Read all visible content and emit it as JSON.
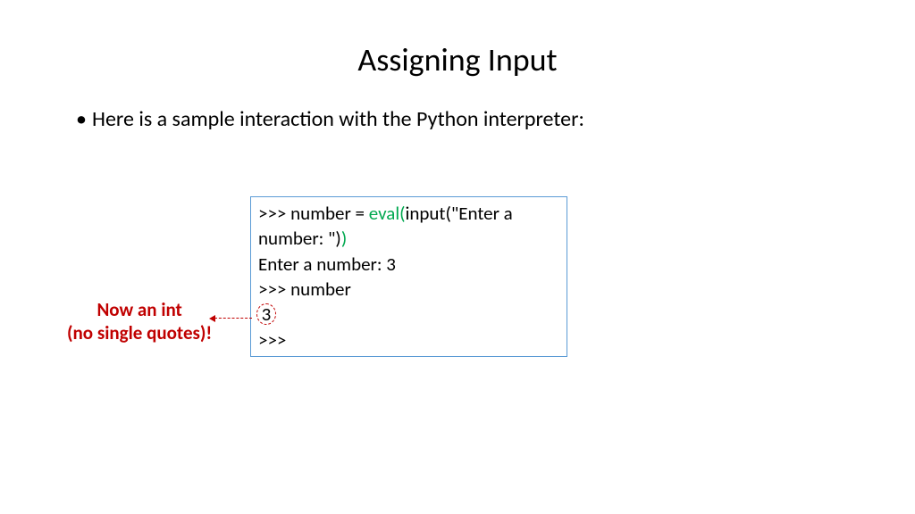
{
  "title": "Assigning Input",
  "bullet": "Here is a sample interaction with the Python interpreter:",
  "code": {
    "line1_prefix": ">>> number = ",
    "eval_open": "eval(",
    "line1_middle": "input(\"Enter a number: \")",
    "eval_close": ")",
    "line2": "Enter a number: 3",
    "line3": ">>> number",
    "line4": "3",
    "line5": ">>>"
  },
  "annotation": {
    "line1": "Now an int",
    "line2": "(no single quotes)!"
  }
}
